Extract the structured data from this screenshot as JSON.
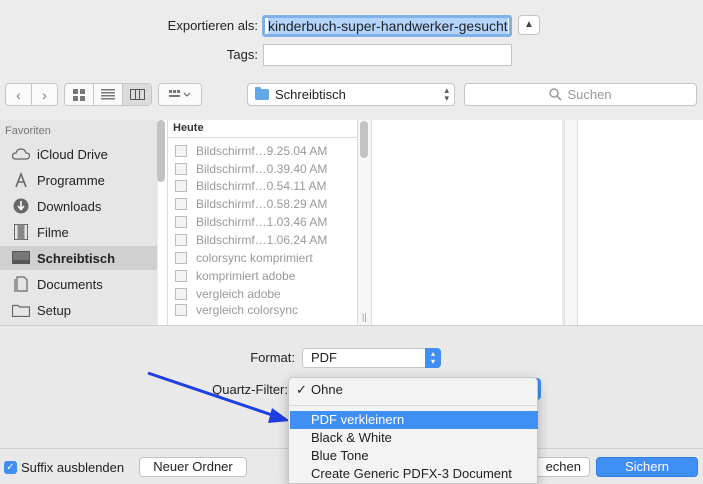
{
  "export": {
    "label": "Exportieren als:",
    "filename": "kinderbuch-super-handwerker-gesucht",
    "tags_label": "Tags:",
    "tags_value": ""
  },
  "toolbar": {
    "location": "Schreibtisch",
    "search_placeholder": "Suchen"
  },
  "sidebar": {
    "header": "Favoriten",
    "items": [
      {
        "label": "iCloud Drive",
        "icon": "cloud-icon"
      },
      {
        "label": "Programme",
        "icon": "apps-icon"
      },
      {
        "label": "Downloads",
        "icon": "download-icon"
      },
      {
        "label": "Filme",
        "icon": "film-icon"
      },
      {
        "label": "Schreibtisch",
        "icon": "desktop-icon",
        "selected": true
      },
      {
        "label": "Documents",
        "icon": "document-icon"
      },
      {
        "label": "Setup",
        "icon": "folder-icon"
      }
    ]
  },
  "browser": {
    "column_header": "Heute",
    "files": [
      "Bildschirmf…9.25.04 AM",
      "Bildschirmf…0.39.40 AM",
      "Bildschirmf…0.54.11 AM",
      "Bildschirmf…0.58.29 AM",
      "Bildschirmf…1.03.46 AM",
      "Bildschirmf…1.06.24 AM",
      "colorsync komprimiert",
      "komprimiert adobe",
      "vergleich adobe",
      "vergleich colorsync"
    ]
  },
  "options": {
    "format_label": "Format:",
    "format_value": "PDF",
    "quartz_label": "Quartz-Filter:"
  },
  "menu": {
    "checkmark": "✓",
    "items": [
      "Ohne",
      "PDF verkleinern",
      "Black & White",
      "Blue Tone",
      "Create Generic PDFX-3 Document"
    ]
  },
  "bottom": {
    "hide_extension_label": "Suffix ausblenden",
    "new_folder_label": "Neuer Ordner",
    "cancel_label_visible": "echen",
    "save_label": "Sichern"
  },
  "colors": {
    "accent": "#3f8ff5",
    "annotation_arrow": "#1f3fe0"
  }
}
